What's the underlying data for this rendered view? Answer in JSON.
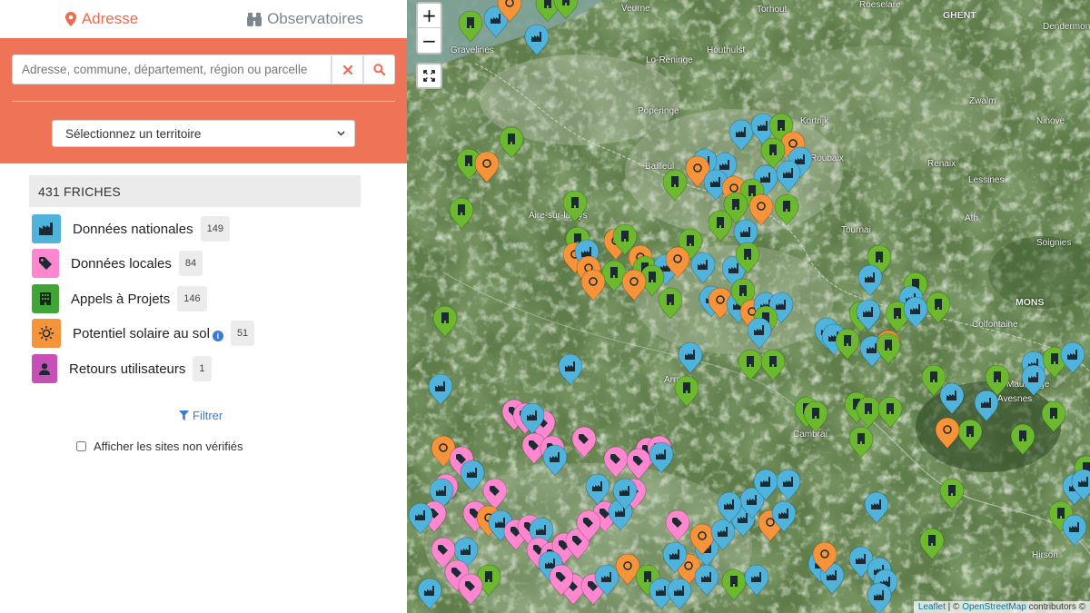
{
  "tabs": {
    "address": "Adresse",
    "observatories": "Observatoires"
  },
  "search": {
    "placeholder": "Adresse, commune, département, région ou parcelle",
    "territory_select": "Sélectionnez un territoire"
  },
  "count_label": "431 FRICHES",
  "legend": [
    {
      "label": "Données nationales",
      "count": "149",
      "color": "#4fb3dc",
      "icon": "factory-icon"
    },
    {
      "label": "Données locales",
      "count": "84",
      "color": "#ff87d0",
      "icon": "tag-icon"
    },
    {
      "label": "Appels à Projets",
      "count": "146",
      "color": "#3fa536",
      "icon": "building-icon"
    },
    {
      "label": "Potentiel solaire au sol",
      "count": "51",
      "color": "#f7943a",
      "icon": "sun-icon"
    },
    {
      "label": "Retours utilisateurs",
      "count": "1",
      "color": "#c84fb6",
      "icon": "user-icon"
    }
  ],
  "filter_label": "Filtrer",
  "unverified_label": "Afficher les sites non vérifiés",
  "map": {
    "zoom_in": "+",
    "zoom_out": "−",
    "attribution_leaflet": "Leaflet",
    "attribution_sep": " | © ",
    "attribution_osm": "OpenStreetMap",
    "attribution_rest": " contributors ©",
    "places": [
      {
        "name": "Veurne",
        "big": false
      },
      {
        "name": "Torhout",
        "big": false
      },
      {
        "name": "Roeselare",
        "big": false
      },
      {
        "name": "GHENT",
        "big": true
      },
      {
        "name": "Dendermon",
        "big": false
      },
      {
        "name": "Gravelines",
        "big": false
      },
      {
        "name": "Houthulst",
        "big": false
      },
      {
        "name": "Lo-Reninge",
        "big": false
      },
      {
        "name": "Poperinge",
        "big": false
      },
      {
        "name": "Kortrijk",
        "big": false
      },
      {
        "name": "Zwalm",
        "big": false
      },
      {
        "name": "Ninove",
        "big": false
      },
      {
        "name": "Bailleul",
        "big": false
      },
      {
        "name": "Roubaix",
        "big": false
      },
      {
        "name": "Renaix",
        "big": false
      },
      {
        "name": "Lessines",
        "big": false
      },
      {
        "name": "Ath",
        "big": false
      },
      {
        "name": "Aire-sur-la-Lys",
        "big": false
      },
      {
        "name": "Tournai",
        "big": false
      },
      {
        "name": "Soignies",
        "big": false
      },
      {
        "name": "MONS",
        "big": true
      },
      {
        "name": "Colfontaine",
        "big": false
      },
      {
        "name": "Arras",
        "big": false
      },
      {
        "name": "Maubeuge",
        "big": false
      },
      {
        "name": "Avesnes",
        "big": false
      },
      {
        "name": "Cambrai",
        "big": false
      },
      {
        "name": "Hirson",
        "big": false
      }
    ]
  }
}
